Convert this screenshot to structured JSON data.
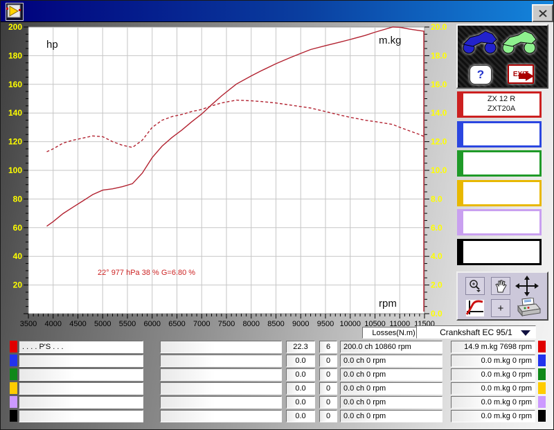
{
  "window": {
    "app_icon": "dyno-curve-icon",
    "close": "close"
  },
  "chart": {
    "hp_label": "hp",
    "torque_label": "m.kg",
    "rpm_label": "rpm",
    "annotation": "22° 977 hPa  38 %    G=6.80 %"
  },
  "chart_data": {
    "type": "line",
    "title": "",
    "xlabel": "rpm",
    "x_axis": {
      "min": 3500,
      "max": 11500,
      "major_step": 500,
      "minor_step": 100
    },
    "y_left": {
      "label": "hp",
      "min": 0,
      "max": 200,
      "major_step": 20,
      "minor_step": 5,
      "tick_color": "#ffff00"
    },
    "y_right": {
      "label": "m.kg",
      "min": 0,
      "max": 20,
      "major_step": 2,
      "minor_step": 0.5,
      "tick_color": "#ffff00"
    },
    "grid": true,
    "grid_color": "#c6c6c6",
    "plot_bg": "#ffffff",
    "curve_color": "#b22230",
    "series": [
      {
        "name": "power_hp",
        "style": "solid",
        "axis": "left",
        "points": [
          [
            3870,
            61
          ],
          [
            4000,
            64.2
          ],
          [
            4200,
            69.8
          ],
          [
            4400,
            74.3
          ],
          [
            4600,
            78.7
          ],
          [
            4800,
            83.1
          ],
          [
            5000,
            86.2
          ],
          [
            5200,
            87.1
          ],
          [
            5400,
            88.6
          ],
          [
            5600,
            90.7
          ],
          [
            5800,
            98
          ],
          [
            6000,
            108.9
          ],
          [
            6200,
            116.9
          ],
          [
            6400,
            122.9
          ],
          [
            6600,
            128.1
          ],
          [
            6800,
            133.9
          ],
          [
            7000,
            139.3
          ],
          [
            7200,
            145.8
          ],
          [
            7400,
            151.9
          ],
          [
            7700,
            160.2
          ],
          [
            8000,
            165.9
          ],
          [
            8200,
            169.4
          ],
          [
            8500,
            174.4
          ],
          [
            8800,
            178.8
          ],
          [
            9000,
            181.6
          ],
          [
            9200,
            184.3
          ],
          [
            9500,
            187
          ],
          [
            9800,
            189.5
          ],
          [
            10000,
            191.3
          ],
          [
            10300,
            194.1
          ],
          [
            10500,
            196.4
          ],
          [
            10860,
            200
          ],
          [
            11000,
            199.8
          ],
          [
            11200,
            198.5
          ],
          [
            11400,
            197.5
          ],
          [
            11500,
            197
          ]
        ]
      },
      {
        "name": "torque_mkg",
        "style": "dashed",
        "axis": "right",
        "points": [
          [
            3870,
            11.3
          ],
          [
            4000,
            11.5
          ],
          [
            4200,
            11.9
          ],
          [
            4400,
            12.1
          ],
          [
            4600,
            12.25
          ],
          [
            4800,
            12.4
          ],
          [
            5000,
            12.35
          ],
          [
            5200,
            12.0
          ],
          [
            5400,
            11.75
          ],
          [
            5600,
            11.6
          ],
          [
            5800,
            12.1
          ],
          [
            6000,
            13.0
          ],
          [
            6200,
            13.5
          ],
          [
            6400,
            13.75
          ],
          [
            6600,
            13.9
          ],
          [
            6800,
            14.1
          ],
          [
            7000,
            14.25
          ],
          [
            7200,
            14.5
          ],
          [
            7400,
            14.7
          ],
          [
            7700,
            14.9
          ],
          [
            8000,
            14.85
          ],
          [
            8200,
            14.8
          ],
          [
            8500,
            14.7
          ],
          [
            8800,
            14.55
          ],
          [
            9000,
            14.45
          ],
          [
            9200,
            14.35
          ],
          [
            9500,
            14.1
          ],
          [
            9800,
            13.85
          ],
          [
            10000,
            13.7
          ],
          [
            10300,
            13.5
          ],
          [
            10500,
            13.4
          ],
          [
            10860,
            13.2
          ],
          [
            11000,
            13.0
          ],
          [
            11200,
            12.75
          ],
          [
            11400,
            12.5
          ],
          [
            11500,
            12.35
          ]
        ]
      }
    ],
    "end_drop_line_rpm": 11500,
    "peak_power": "200.0 ch 10860 rpm",
    "peak_torque": "14.9 m.kg 7698 rpm"
  },
  "side_panel": {
    "bike_blue": "blue-motorcycle-button",
    "bike_green": "green-motorcycle-button",
    "help_label": "?",
    "exit_label": "EXIT",
    "slots": [
      {
        "color": "#cc2020",
        "line1": "ZX 12 R",
        "line2": "ZXT20A"
      },
      {
        "color": "#2b46e0",
        "line1": "",
        "line2": ""
      },
      {
        "color": "#1f9a28",
        "line1": "",
        "line2": ""
      },
      {
        "color": "#e8b800",
        "line1": "",
        "line2": ""
      },
      {
        "color": "#c9a0f0",
        "line1": "",
        "line2": ""
      },
      {
        "color": "#000000",
        "line1": "",
        "line2": ""
      }
    ]
  },
  "tools": {
    "zoom": "magnifier-zoom-button",
    "pan": "hand-pan-button",
    "move": "four-way-arrows-icon",
    "graph": "graph-scale-button",
    "plus": "+",
    "print": "printer-button"
  },
  "losses": {
    "label": "Losses(N.m)",
    "selected": "Crankshaft EC 95/1"
  },
  "table": {
    "rows": [
      {
        "color": "#e00000",
        "name": ". . . . P'S . . .",
        "spec": "",
        "val1": "22.3",
        "val2": "6",
        "power": "200.0 ch 10860 rpm",
        "torque": "14.9 m.kg 7698 rpm"
      },
      {
        "color": "#2233ee",
        "name": "",
        "spec": "",
        "val1": "0.0",
        "val2": "0",
        "power": "0.0 ch 0 rpm",
        "torque": "0.0 m.kg 0 rpm"
      },
      {
        "color": "#0f8818",
        "name": "",
        "spec": "",
        "val1": "0.0",
        "val2": "0",
        "power": "0.0 ch 0 rpm",
        "torque": "0.0 m.kg 0 rpm"
      },
      {
        "color": "#ffcc00",
        "name": "",
        "spec": "",
        "val1": "0.0",
        "val2": "0",
        "power": "0.0 ch 0 rpm",
        "torque": "0.0 m.kg 0 rpm"
      },
      {
        "color": "#cc99ff",
        "name": "",
        "spec": "",
        "val1": "0.0",
        "val2": "0",
        "power": "0.0 ch 0 rpm",
        "torque": "0.0 m.kg 0 rpm"
      },
      {
        "color": "#000000",
        "name": "",
        "spec": "",
        "val1": "0.0",
        "val2": "0",
        "power": "0.0 ch 0 rpm",
        "torque": "0.0 m.kg 0 rpm"
      }
    ]
  }
}
